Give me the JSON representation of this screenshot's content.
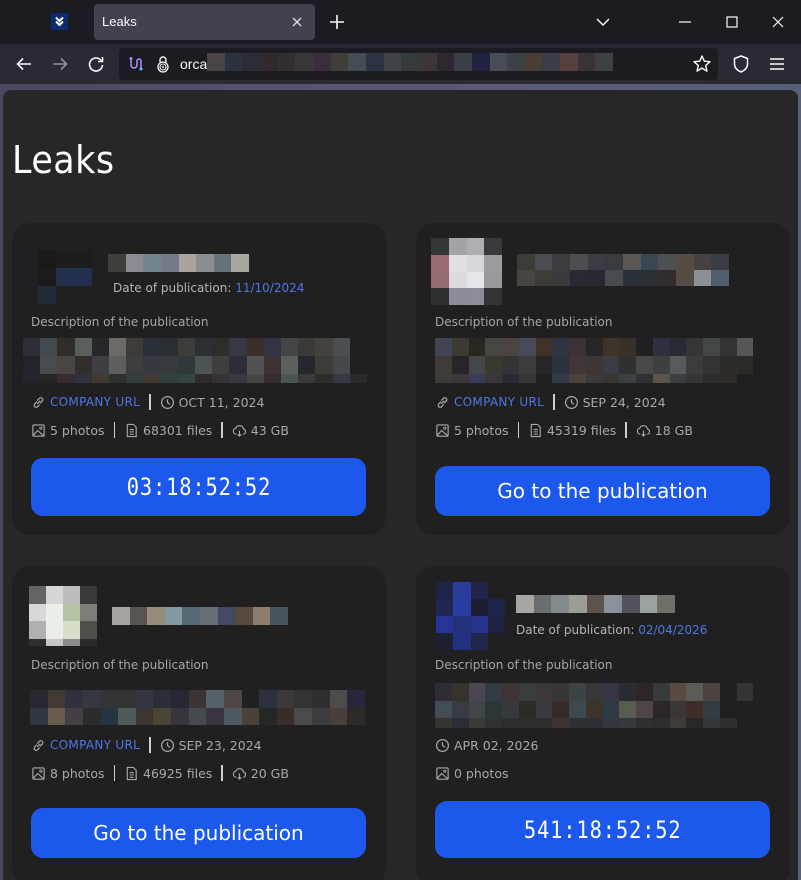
{
  "browser": {
    "tab_title": "Leaks",
    "url_prefix": "orca",
    "url_redacted_colors": [
      "#4a4446",
      "#2c3340",
      "#2b2d35",
      "#302a2d",
      "#332e30",
      "#3a3738",
      "#3a2e3a",
      "#3f3e38",
      "#464d52",
      "#2e3344",
      "#3f4347",
      "#353a3c",
      "#3d3638",
      "#2f2830",
      "#3a4046",
      "#1f2240",
      "#484c55",
      "#3c4244",
      "#4a3d36",
      "#3a3e44",
      "#573f3d",
      "#3b3236",
      "#3e4148"
    ],
    "icons": {
      "favicon": "chevron-double-down-icon",
      "tab_close": "close-icon",
      "new_tab": "plus-icon",
      "tab_list": "chevron-down-icon",
      "minimize": "minimize-icon",
      "maximize": "maximize-icon",
      "close": "close-icon",
      "back": "arrow-left-icon",
      "forward": "arrow-right-icon",
      "reload": "reload-icon",
      "extension": "extension-icon",
      "lock": "fingerprint-lock-icon",
      "bookmark": "star-icon",
      "shield": "shield-icon",
      "menu": "hamburger-menu-icon"
    }
  },
  "page": {
    "title": "Leaks",
    "colors": {
      "accent": "#1d58ed",
      "link": "#4e77e6",
      "card_bg": "#202020",
      "page_bg": "#272727"
    }
  },
  "cards": [
    {
      "publication_date_label": "Date of publication:",
      "publication_date": "11/10/2024",
      "description_label": "Description of the publication",
      "company_url_label": "COMPANY URL",
      "date": "OCT 11, 2024",
      "photos": "5 photos",
      "files": "68301 files",
      "size": "43 GB",
      "button_label": "03:18:52:52",
      "button_type": "timer"
    },
    {
      "description_label": "Description of the publication",
      "company_url_label": "COMPANY URL",
      "date": "SEP 24, 2024",
      "photos": "5 photos",
      "files": "45319 files",
      "size": "18 GB",
      "button_label": "Go to the publication",
      "button_type": "link"
    },
    {
      "description_label": "Description of the publication",
      "company_url_label": "COMPANY URL",
      "date": "SEP 23, 2024",
      "photos": "8 photos",
      "files": "46925 files",
      "size": "20 GB",
      "button_label": "Go to the publication",
      "button_type": "link"
    },
    {
      "publication_date_label": "Date of publication:",
      "publication_date": "02/04/2026",
      "description_label": "Description of the publication",
      "date": "APR 02, 2026",
      "photos": "0 photos",
      "button_label": "541:18:52:52",
      "button_type": "timer"
    }
  ],
  "redacted": {
    "card1_logo": [
      "#1f2024",
      "#191a19",
      "#1c1d1d",
      "#1c1d1d",
      "#1f2024",
      "#1d1c1c",
      "#22304d",
      "#22304d",
      "#202020",
      "#222a38",
      "#202020",
      "#202020"
    ],
    "card1_name": [
      "#3f3e3b",
      "#8d8a93",
      "#718591",
      "#727a8c",
      "#aaa59c",
      "#8b8d8e",
      "#647279",
      "#a9a8a0"
    ],
    "card2_logo": [
      "#353535",
      "#a4a2a7",
      "#aeadb1",
      "#3a393b",
      "#9a6b72",
      "#e0dfe4",
      "#d8d7dc",
      "#9c9ba0",
      "#946a70",
      "#dcdbe1",
      "#e6e5e9",
      "#9a999e",
      "#2f2f31",
      "#8e8b98",
      "#8e8c99",
      "#333335"
    ],
    "card2_name": [
      "#3b3b38",
      "#494d51",
      "#3c3c3f",
      "#4e4e51",
      "#3d3c45",
      "#3a3b3d",
      "#5a5754",
      "#3a4652",
      "#4e4f50",
      "#564c45",
      "#464241",
      "#3a3c42",
      "#48443f",
      "#3c3b36",
      "#3a3a3b",
      "#2a2932",
      "#29272f",
      "#474c51",
      "#2a3138",
      "#2b3034",
      "#332c2d",
      "#544b44",
      "#8b9096",
      "#515d6b"
    ],
    "card3_logo": [
      "#646464",
      "#d6d6d6",
      "#bcbcbc",
      "#3a3a3a",
      "#d8d8d8",
      "#eceee9",
      "#b4c4a2",
      "#7c7f78",
      "#b0b0b0",
      "#ebede7",
      "#d6dfcc",
      "#4e504a",
      "#2e2e2e",
      "#c5c5c5",
      "#8c8c8c",
      "#2a2a2a"
    ],
    "card3_name": [
      "#a8a39e",
      "#5a5450",
      "#978c7a",
      "#839aa3",
      "#566776",
      "#666d76",
      "#464665",
      "#5a4a3e",
      "#8c7e6a",
      "#48555f"
    ],
    "card4_logo": [
      "#1e2448",
      "#2b3c9c",
      "#1f2448",
      "#202020",
      "#1f2655",
      "#2a3da3",
      "#1b1e33",
      "#1e2448",
      "#263494",
      "#25307c",
      "#27328a",
      "#1e2242",
      "#1c2030",
      "#223080",
      "#20254a",
      "#202020"
    ],
    "card4_name": [
      "#a7a6a2",
      "#6a6e6f",
      "#838a8e",
      "#9d9d98",
      "#5c544c",
      "#88929b",
      "#52515c",
      "#9ca2a2",
      "#6f6f65"
    ],
    "desc1": [
      "#2e2e36",
      "#434a4f",
      "#302c27",
      "#5b5f5b",
      "#25272b",
      "#6d6966",
      "#3e3b38",
      "#2a3037",
      "#2a2e33",
      "#3c3d39",
      "#2c2f33",
      "#2f2d2a",
      "#363843",
      "#3a2f29",
      "#313443",
      "#444646",
      "#3b3a38",
      "#45413c",
      "#4b4e51",
      "#202020",
      "#23242a",
      "#484b4e",
      "#4a4542",
      "#312e2b",
      "#3e3f44",
      "#5e5e5c",
      "#3e3e3e",
      "#353840",
      "#363a3b",
      "#2f393b",
      "#4d5256",
      "#3f3e3f",
      "#2e2d37",
      "#505254",
      "#3b3231",
      "#5a605d",
      "#26272d",
      "#3e3c37",
      "#45484b",
      "#202020",
      "#24242b",
      "#252522",
      "#352d2f",
      "#2f3340",
      "#423a31",
      "#2d312e",
      "#333c40",
      "#433a36",
      "#314042",
      "#334543",
      "#302a2c",
      "#353336",
      "#383840",
      "#464644",
      "#362c32",
      "#4c5552",
      "#3a3a3a",
      "#2f2d2b",
      "#333a42",
      "#2b2a28"
    ],
    "desc2": [
      "#3f4555",
      "#3d3935",
      "#2c2621",
      "#464743",
      "#4c4440",
      "#474858",
      "#3f3328",
      "#2e3444",
      "#3c3136",
      "#262626",
      "#3d352b",
      "#383129",
      "#202020",
      "#2e3141",
      "#262b33",
      "#373533",
      "#434747",
      "#333334",
      "#555555",
      "#202020",
      "#3f3a33",
      "#2a2427",
      "#45464a",
      "#3a3833",
      "#333534",
      "#3c3c3c",
      "#262628",
      "#2c3140",
      "#403538",
      "#3c3735",
      "#393c42",
      "#2f3131",
      "#484846",
      "#3d403f",
      "#575a5d",
      "#3c3c3b",
      "#343333",
      "#2e2c29",
      "#2b2a27",
      "#202020",
      "#3b3b38",
      "#3d373b",
      "#3b3b5c",
      "#3a3836",
      "#2b2a33",
      "#363636",
      "#202020",
      "#323a44",
      "#4b433e",
      "#3a3a3a",
      "#383631",
      "#3b4043",
      "#323131",
      "#5a544a",
      "#394043",
      "#353536",
      "#2b2c2e",
      "#302b28",
      "#202020",
      "#202020"
    ],
    "desc3": [
      "#2b2730",
      "#413a33",
      "#30303e",
      "#353840",
      "#343434",
      "#333333",
      "#333640",
      "#2a2e39",
      "#272733",
      "#3a3534",
      "#556068",
      "#4d4645",
      "#202020",
      "#2c3140",
      "#3b383c",
      "#323433",
      "#302e2c",
      "#4d4c4b",
      "#28263a",
      "#313740",
      "#6a5c4c",
      "#433f45",
      "#2c2c2a",
      "#243541",
      "#4e5a5a",
      "#3c3632",
      "#4a4435",
      "#37343c",
      "#464a4e",
      "#39343d",
      "#4e5860",
      "#4a4237",
      "#262626",
      "#382e29",
      "#4a4a4a",
      "#3b3d41",
      "#473f38",
      "#2c2926"
    ],
    "desc4": [
      "#2f2c36",
      "#36332e",
      "#4a4750",
      "#333c44",
      "#3e3433",
      "#383d3b",
      "#3a3838",
      "#363637",
      "#3d4345",
      "#393637",
      "#343743",
      "#2a2c32",
      "#2e2526",
      "#373a39",
      "#5a4a40",
      "#5b5c57",
      "#4a4340",
      "#202020",
      "#343434",
      "#202020",
      "#434c53",
      "#393b40",
      "#3f4645",
      "#2c3538",
      "#36393c",
      "#2a2a26",
      "#383a3e",
      "#372a2b",
      "#3c4a50",
      "#3c332b",
      "#2c3a42",
      "#595a50",
      "#4d4548",
      "#2b2628",
      "#383934",
      "#3f2d28",
      "#323c42",
      "#202020",
      "#202020",
      "#202020",
      "#353431",
      "#2b2d36",
      "#3a3b37",
      "#2f3133",
      "#2d2e2f",
      "#2d2d2e",
      "#2c2e2c",
      "#3e3232",
      "#2d3034",
      "#2d3035",
      "#333640",
      "#323a3e",
      "#2e3030",
      "#2c2d2d",
      "#3e3b36",
      "#2a2729",
      "#33373a",
      "#2d2d2d",
      "#202020",
      "#202020"
    ]
  }
}
